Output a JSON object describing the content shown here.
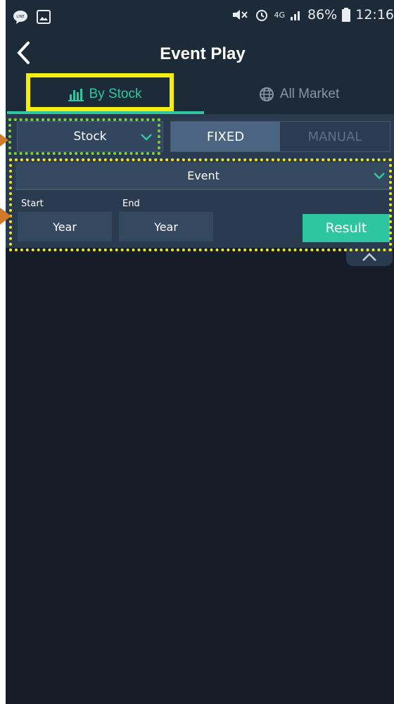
{
  "status_bar": {
    "network": "4G",
    "battery": "86%",
    "time": "12:16"
  },
  "app_bar": {
    "title": "Event Play"
  },
  "tabs": [
    {
      "label": "By Stock",
      "icon": "bar-chart-icon",
      "active": true
    },
    {
      "label": "All Market",
      "icon": "globe-icon",
      "active": false
    }
  ],
  "controls": {
    "stock_select": "Stock",
    "mode_fixed": "FIXED",
    "mode_manual": "MANUAL",
    "event_select": "Event",
    "start_label": "Start",
    "end_label": "End",
    "start_value": "Year",
    "end_value": "Year",
    "result_button": "Result"
  },
  "colors": {
    "accent": "#2ec7a0",
    "background": "#141d28",
    "panel": "#2a3a4f",
    "annotation_yellow": "#f2ee10",
    "annotation_green": "#7fd43a",
    "annotation_arrow": "#d07a2a"
  }
}
